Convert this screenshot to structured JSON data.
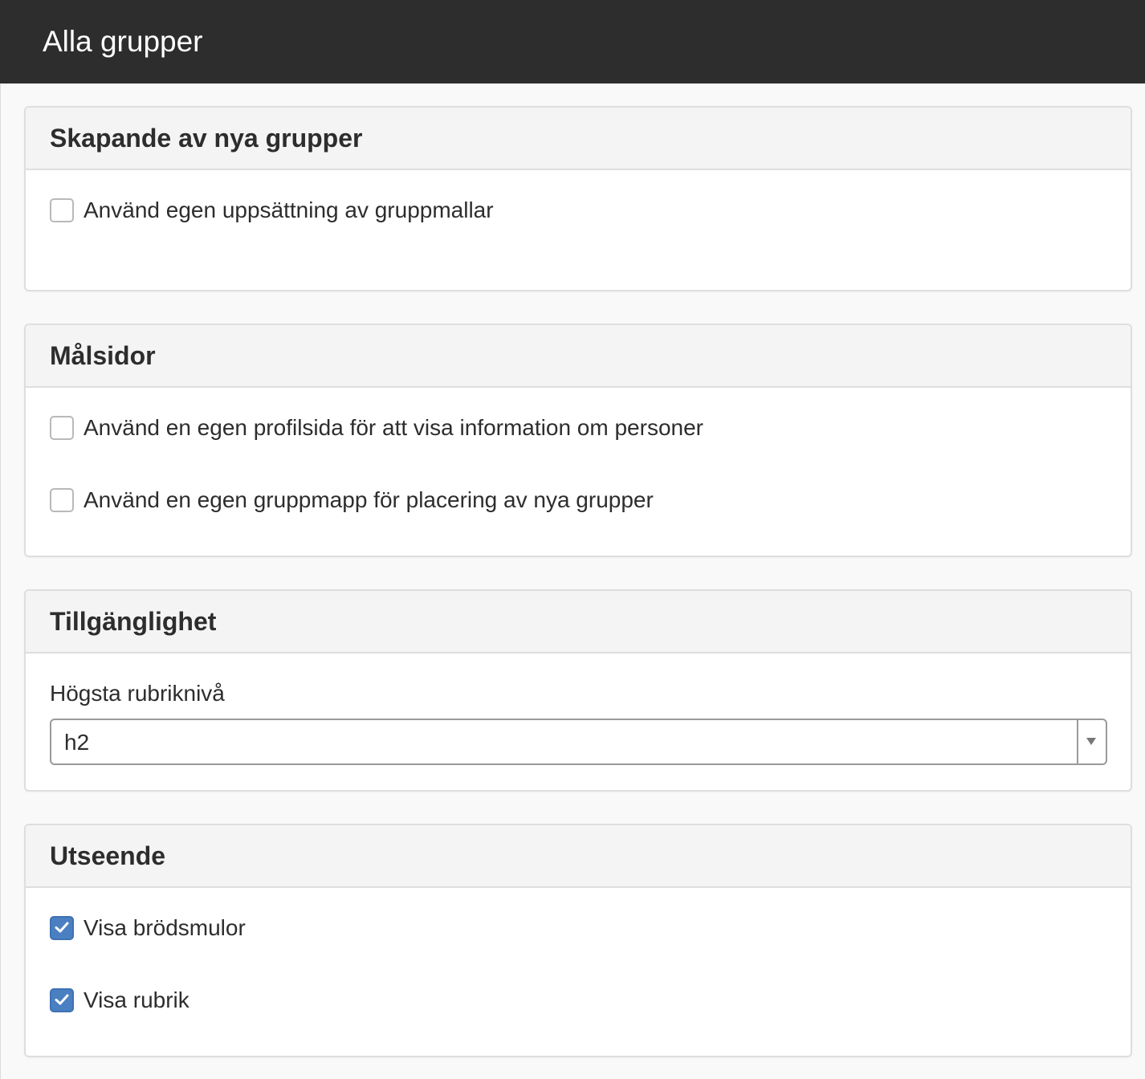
{
  "window": {
    "title": "Alla grupper"
  },
  "sections": [
    {
      "title": "Skapande av nya grupper",
      "checkboxes": [
        {
          "label": "Använd egen uppsättning av gruppmallar",
          "checked": false
        }
      ]
    },
    {
      "title": "Målsidor",
      "checkboxes": [
        {
          "label": "Använd en egen profilsida för att visa information om personer",
          "checked": false
        },
        {
          "label": "Använd en egen gruppmapp för placering av nya grupper",
          "checked": false
        }
      ]
    },
    {
      "title": "Tillgänglighet",
      "select": {
        "label": "Högsta rubriknivå",
        "value": "h2"
      }
    },
    {
      "title": "Utseende",
      "checkboxes": [
        {
          "label": "Visa brödsmulor",
          "checked": true
        },
        {
          "label": "Visa rubrik",
          "checked": true
        }
      ]
    }
  ],
  "colors": {
    "titlebar_bg": "#2d2d2d",
    "checkbox_checked": "#4a7fc1",
    "panel_header_bg": "#f4f4f4"
  }
}
